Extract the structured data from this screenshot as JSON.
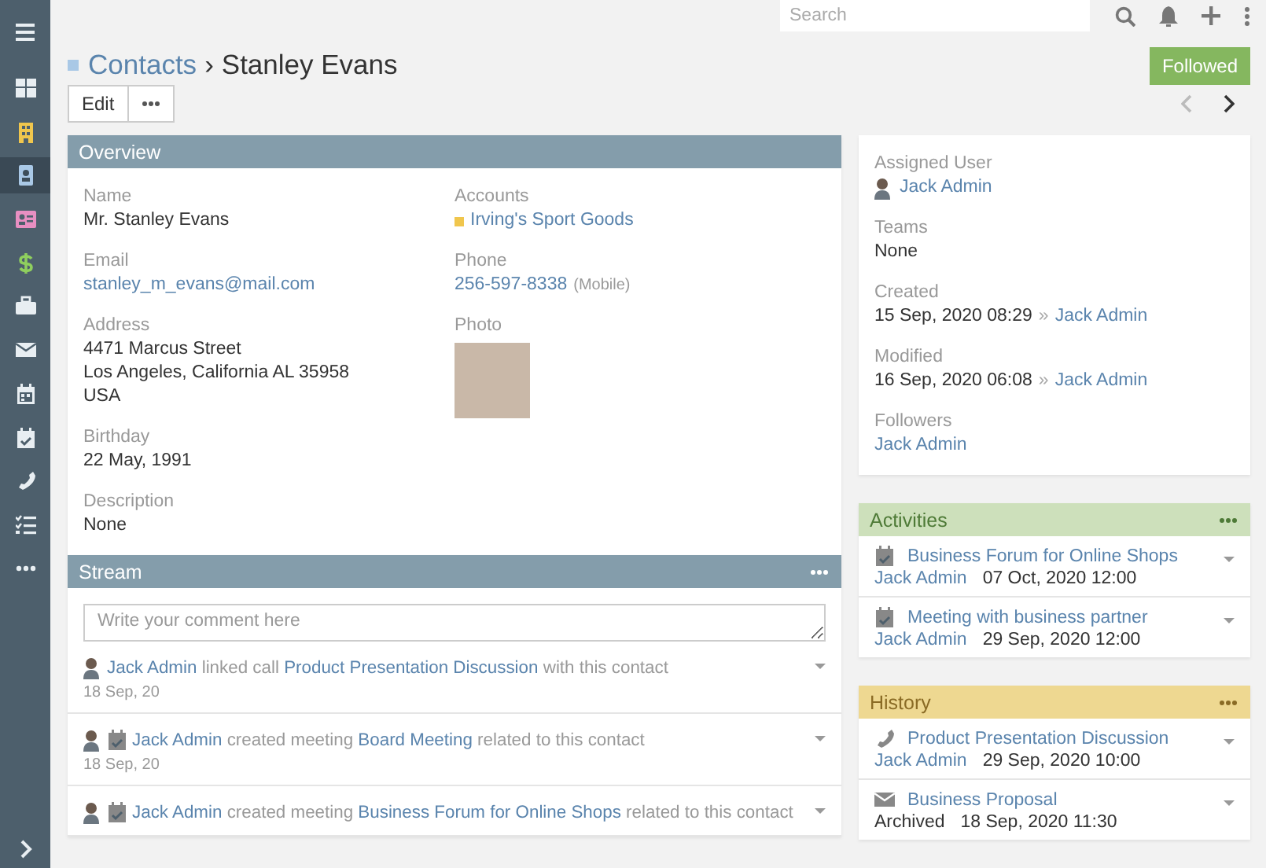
{
  "sidebar": {
    "items": [
      {
        "kind": "dashboard",
        "selected": false,
        "color": "#e8eef2"
      },
      {
        "kind": "building",
        "selected": false,
        "color": "#f0c64d"
      },
      {
        "kind": "contact",
        "selected": true,
        "color": "#a9c8e6"
      },
      {
        "kind": "card",
        "selected": false,
        "color": "#e88fc2"
      },
      {
        "kind": "dollar",
        "selected": false,
        "color": "#8fcf5e"
      },
      {
        "kind": "briefcase",
        "selected": false,
        "color": "#e8eef2"
      },
      {
        "kind": "envelope",
        "selected": false,
        "color": "#e8eef2"
      },
      {
        "kind": "calendar",
        "selected": false,
        "color": "#e8eef2"
      },
      {
        "kind": "calcheck",
        "selected": false,
        "color": "#e8eef2"
      },
      {
        "kind": "phone",
        "selected": false,
        "color": "#e8eef2"
      },
      {
        "kind": "tasks",
        "selected": false,
        "color": "#e8eef2"
      },
      {
        "kind": "more",
        "selected": false,
        "color": "#e8eef2"
      }
    ]
  },
  "topbar": {
    "search": {
      "placeholder": "Search"
    }
  },
  "header": {
    "breadcrumb": "Contacts",
    "separator": "›",
    "title": "Stanley Evans",
    "follow_button": "Followed"
  },
  "actions": {
    "buttons": [
      "Edit"
    ]
  },
  "overview": {
    "title": "Overview",
    "columns": [
      [
        {
          "kind": "text",
          "label": "Name",
          "value": "Mr. Stanley Evans"
        },
        {
          "kind": "link",
          "label": "Email",
          "value": "stanley_m_evans@mail.com"
        },
        {
          "kind": "lines",
          "label": "Address",
          "lines": [
            "4471 Marcus Street",
            "Los Angeles, California AL 35958",
            "USA"
          ]
        },
        {
          "kind": "text",
          "label": "Birthday",
          "value": "22 May, 1991"
        },
        {
          "kind": "text",
          "label": "Description",
          "value": "None"
        }
      ],
      [
        {
          "kind": "account",
          "label": "Accounts",
          "value": "Irving's Sport Goods",
          "color": "#f0c64d"
        },
        {
          "kind": "phone",
          "label": "Phone",
          "value": "256-597-8338",
          "note": "(Mobile)"
        },
        {
          "kind": "photo",
          "label": "Photo"
        }
      ]
    ]
  },
  "stream": {
    "title": "Stream",
    "comment": {
      "placeholder": "Write your comment here"
    },
    "notes": [
      {
        "kind": "call",
        "user": "Jack Admin",
        "action": "linked call",
        "target": "Product Presentation Discussion",
        "suffix": "with this contact",
        "date": "18 Sep, 20"
      },
      {
        "kind": "meeting",
        "user": "Jack Admin",
        "action": "created meeting",
        "target": "Board Meeting",
        "suffix": "related to this contact",
        "date": "18 Sep, 20"
      },
      {
        "kind": "meeting",
        "user": "Jack Admin",
        "action": "created meeting",
        "target": "Business Forum for Online Shops",
        "suffix": "related to this contact"
      }
    ]
  },
  "side": {
    "fields": [
      {
        "kind": "user",
        "label": "Assigned User",
        "value": "Jack Admin"
      },
      {
        "kind": "text",
        "label": "Teams",
        "value": "None"
      },
      {
        "kind": "stamp",
        "label": "Created",
        "value": "15 Sep, 2020 08:29",
        "marker": "»",
        "by": "Jack Admin"
      },
      {
        "kind": "stamp",
        "label": "Modified",
        "value": "16 Sep, 2020 06:08",
        "marker": "»",
        "by": "Jack Admin"
      },
      {
        "kind": "link",
        "label": "Followers",
        "value": "Jack Admin"
      }
    ]
  },
  "activities": {
    "title": "Activities",
    "items": [
      {
        "kind": "meeting",
        "name": "Business Forum for Online Shops",
        "user": "Jack Admin",
        "date": "07 Oct, 2020 12:00"
      },
      {
        "kind": "meeting",
        "name": "Meeting with business partner",
        "user": "Jack Admin",
        "date": "29 Sep, 2020 12:00"
      }
    ]
  },
  "history": {
    "title": "History",
    "items": [
      {
        "kind": "call",
        "name": "Product Presentation Discussion",
        "user": "Jack Admin",
        "date": "29 Sep, 2020 10:00"
      },
      {
        "kind": "email",
        "name": "Business Proposal",
        "status": "Archived",
        "date": "18 Sep, 2020 11:30"
      }
    ]
  }
}
